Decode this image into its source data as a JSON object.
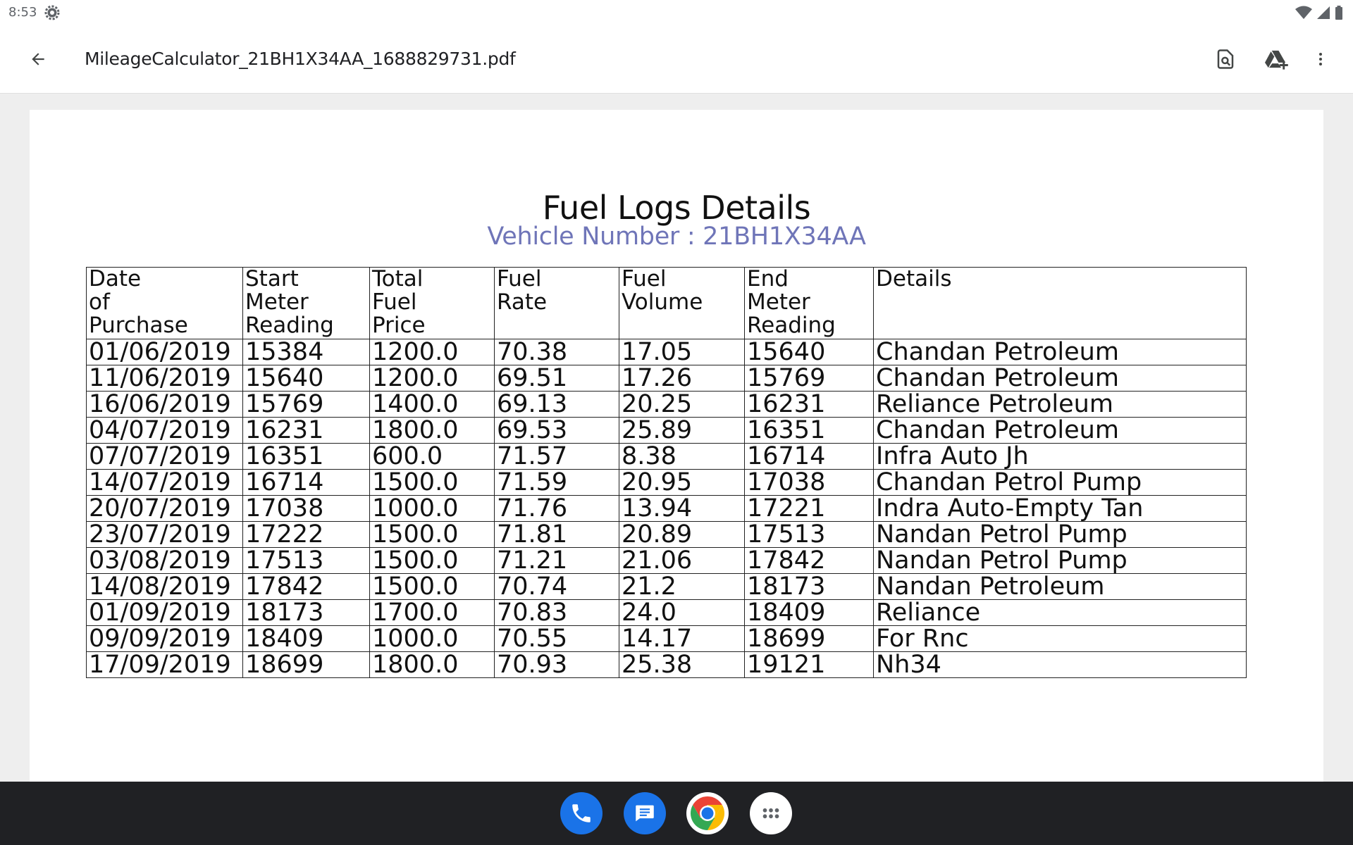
{
  "status_bar": {
    "time": "8:53",
    "icons": [
      "settings-gear-icon",
      "wifi-icon",
      "cell-signal-icon",
      "battery-icon"
    ]
  },
  "app_bar": {
    "title": "MileageCalculator_21BH1X34AA_1688829731.pdf",
    "icons": [
      "back-arrow-icon",
      "find-in-document-icon",
      "add-to-drive-icon",
      "more-vert-icon"
    ]
  },
  "document": {
    "heading": "Fuel Logs Details",
    "subheading": "Vehicle Number : 21BH1X34AA",
    "subheading_color": "#6f75b8",
    "columns": [
      "Date of Purchase",
      "Start Meter Reading",
      "Total Fuel Price",
      "Fuel Rate",
      "Fuel Volume",
      "End Meter Reading",
      "Details"
    ],
    "rows": [
      [
        "01/06/2019",
        "15384",
        "1200.0",
        "70.38",
        "17.05",
        "15640",
        "Chandan Petroleum"
      ],
      [
        "11/06/2019",
        "15640",
        "1200.0",
        "69.51",
        "17.26",
        "15769",
        "Chandan Petroleum"
      ],
      [
        "16/06/2019",
        "15769",
        "1400.0",
        "69.13",
        "20.25",
        "16231",
        "Reliance Petroleum"
      ],
      [
        "04/07/2019",
        "16231",
        "1800.0",
        "69.53",
        "25.89",
        "16351",
        "Chandan Petroleum"
      ],
      [
        "07/07/2019",
        "16351",
        "600.0",
        "71.57",
        "8.38",
        "16714",
        "Infra Auto Jh"
      ],
      [
        "14/07/2019",
        "16714",
        "1500.0",
        "71.59",
        "20.95",
        "17038",
        "Chandan Petrol Pump"
      ],
      [
        "20/07/2019",
        "17038",
        "1000.0",
        "71.76",
        "13.94",
        "17221",
        "Indra Auto-Empty Tan"
      ],
      [
        "23/07/2019",
        "17222",
        "1500.0",
        "71.81",
        "20.89",
        "17513",
        "Nandan Petrol Pump"
      ],
      [
        "03/08/2019",
        "17513",
        "1500.0",
        "71.21",
        "21.06",
        "17842",
        "Nandan Petrol Pump"
      ],
      [
        "14/08/2019",
        "17842",
        "1500.0",
        "70.74",
        "21.2",
        "18173",
        "Nandan Petroleum"
      ],
      [
        "01/09/2019",
        "18173",
        "1700.0",
        "70.83",
        "24.0",
        "18409",
        "Reliance"
      ],
      [
        "09/09/2019",
        "18409",
        "1000.0",
        "70.55",
        "14.17",
        "18699",
        "For Rnc"
      ],
      [
        "17/09/2019",
        "18699",
        "1800.0",
        "70.93",
        "25.38",
        "19121",
        "Nh34"
      ]
    ]
  },
  "dock": {
    "apps": [
      {
        "icon": "phone-icon",
        "color": "#1a73e8"
      },
      {
        "icon": "messages-icon",
        "color": "#1a73e8"
      },
      {
        "icon": "chrome-icon",
        "color": "#ffffff"
      },
      {
        "icon": "app-drawer-icon",
        "color": "#ffffff"
      }
    ]
  }
}
